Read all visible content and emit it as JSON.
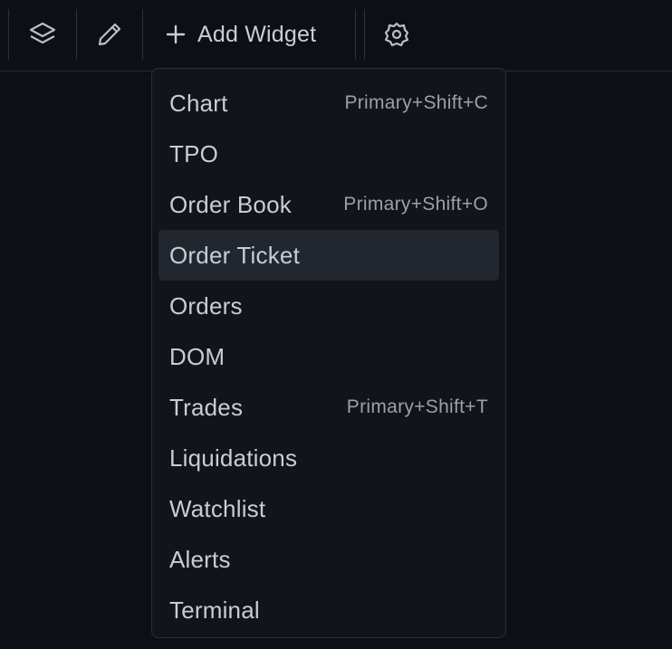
{
  "toolbar": {
    "layers_icon": "layers-icon",
    "edit_icon": "pencil-icon",
    "add_widget_label": "Add Widget",
    "settings_icon": "gear-icon"
  },
  "menu": {
    "items": [
      {
        "label": "Chart",
        "shortcut": "Primary+Shift+C"
      },
      {
        "label": "TPO",
        "shortcut": ""
      },
      {
        "label": "Order Book",
        "shortcut": "Primary+Shift+O"
      },
      {
        "label": "Order Ticket",
        "shortcut": "",
        "highlighted": true
      },
      {
        "label": "Orders",
        "shortcut": ""
      },
      {
        "label": "DOM",
        "shortcut": ""
      },
      {
        "label": "Trades",
        "shortcut": "Primary+Shift+T"
      },
      {
        "label": "Liquidations",
        "shortcut": ""
      },
      {
        "label": "Watchlist",
        "shortcut": ""
      },
      {
        "label": "Alerts",
        "shortcut": ""
      },
      {
        "label": "Terminal",
        "shortcut": ""
      }
    ]
  },
  "colors": {
    "background": "#0c0f14",
    "menu_background": "#111419",
    "highlight": "#22262e",
    "text": "#c8cdd5",
    "shortcut_text": "#9aa0aa"
  }
}
